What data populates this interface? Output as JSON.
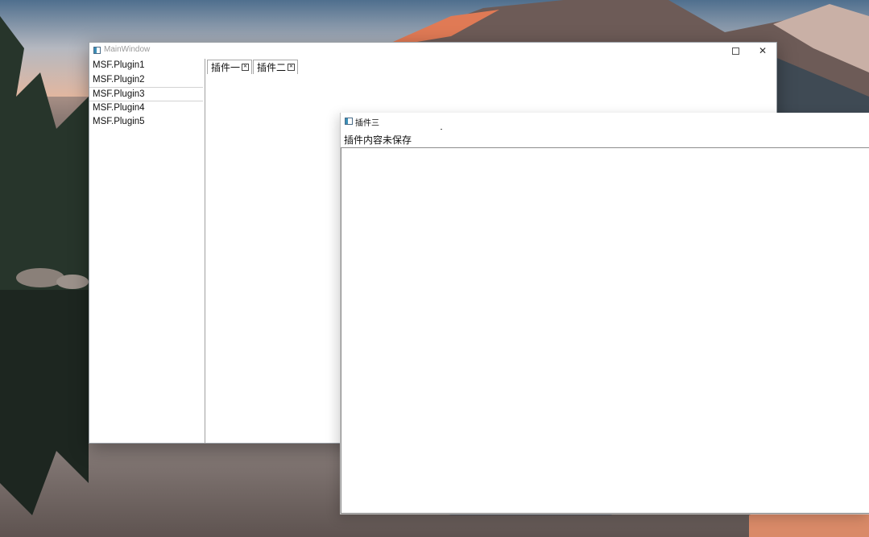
{
  "main_window": {
    "title": "MainWindow",
    "icon": "app-icon",
    "plugins": [
      "MSF.Plugin1",
      "MSF.Plugin2",
      "MSF.Plugin3",
      "MSF.Plugin4",
      "MSF.Plugin5"
    ],
    "selected_plugin": "MSF.Plugin3",
    "tabs": [
      {
        "label": "插件一",
        "close_icon": "close-box-icon"
      },
      {
        "label": "插件二",
        "close_icon": "close-box-icon"
      }
    ],
    "controls": {
      "maximize_icon": "maximize-icon",
      "close_icon": "close-icon",
      "close_glyph": "✕"
    }
  },
  "plugin_window": {
    "title": "插件三",
    "icon": "app-icon",
    "label": "插件内容未保存",
    "text_value": ""
  }
}
